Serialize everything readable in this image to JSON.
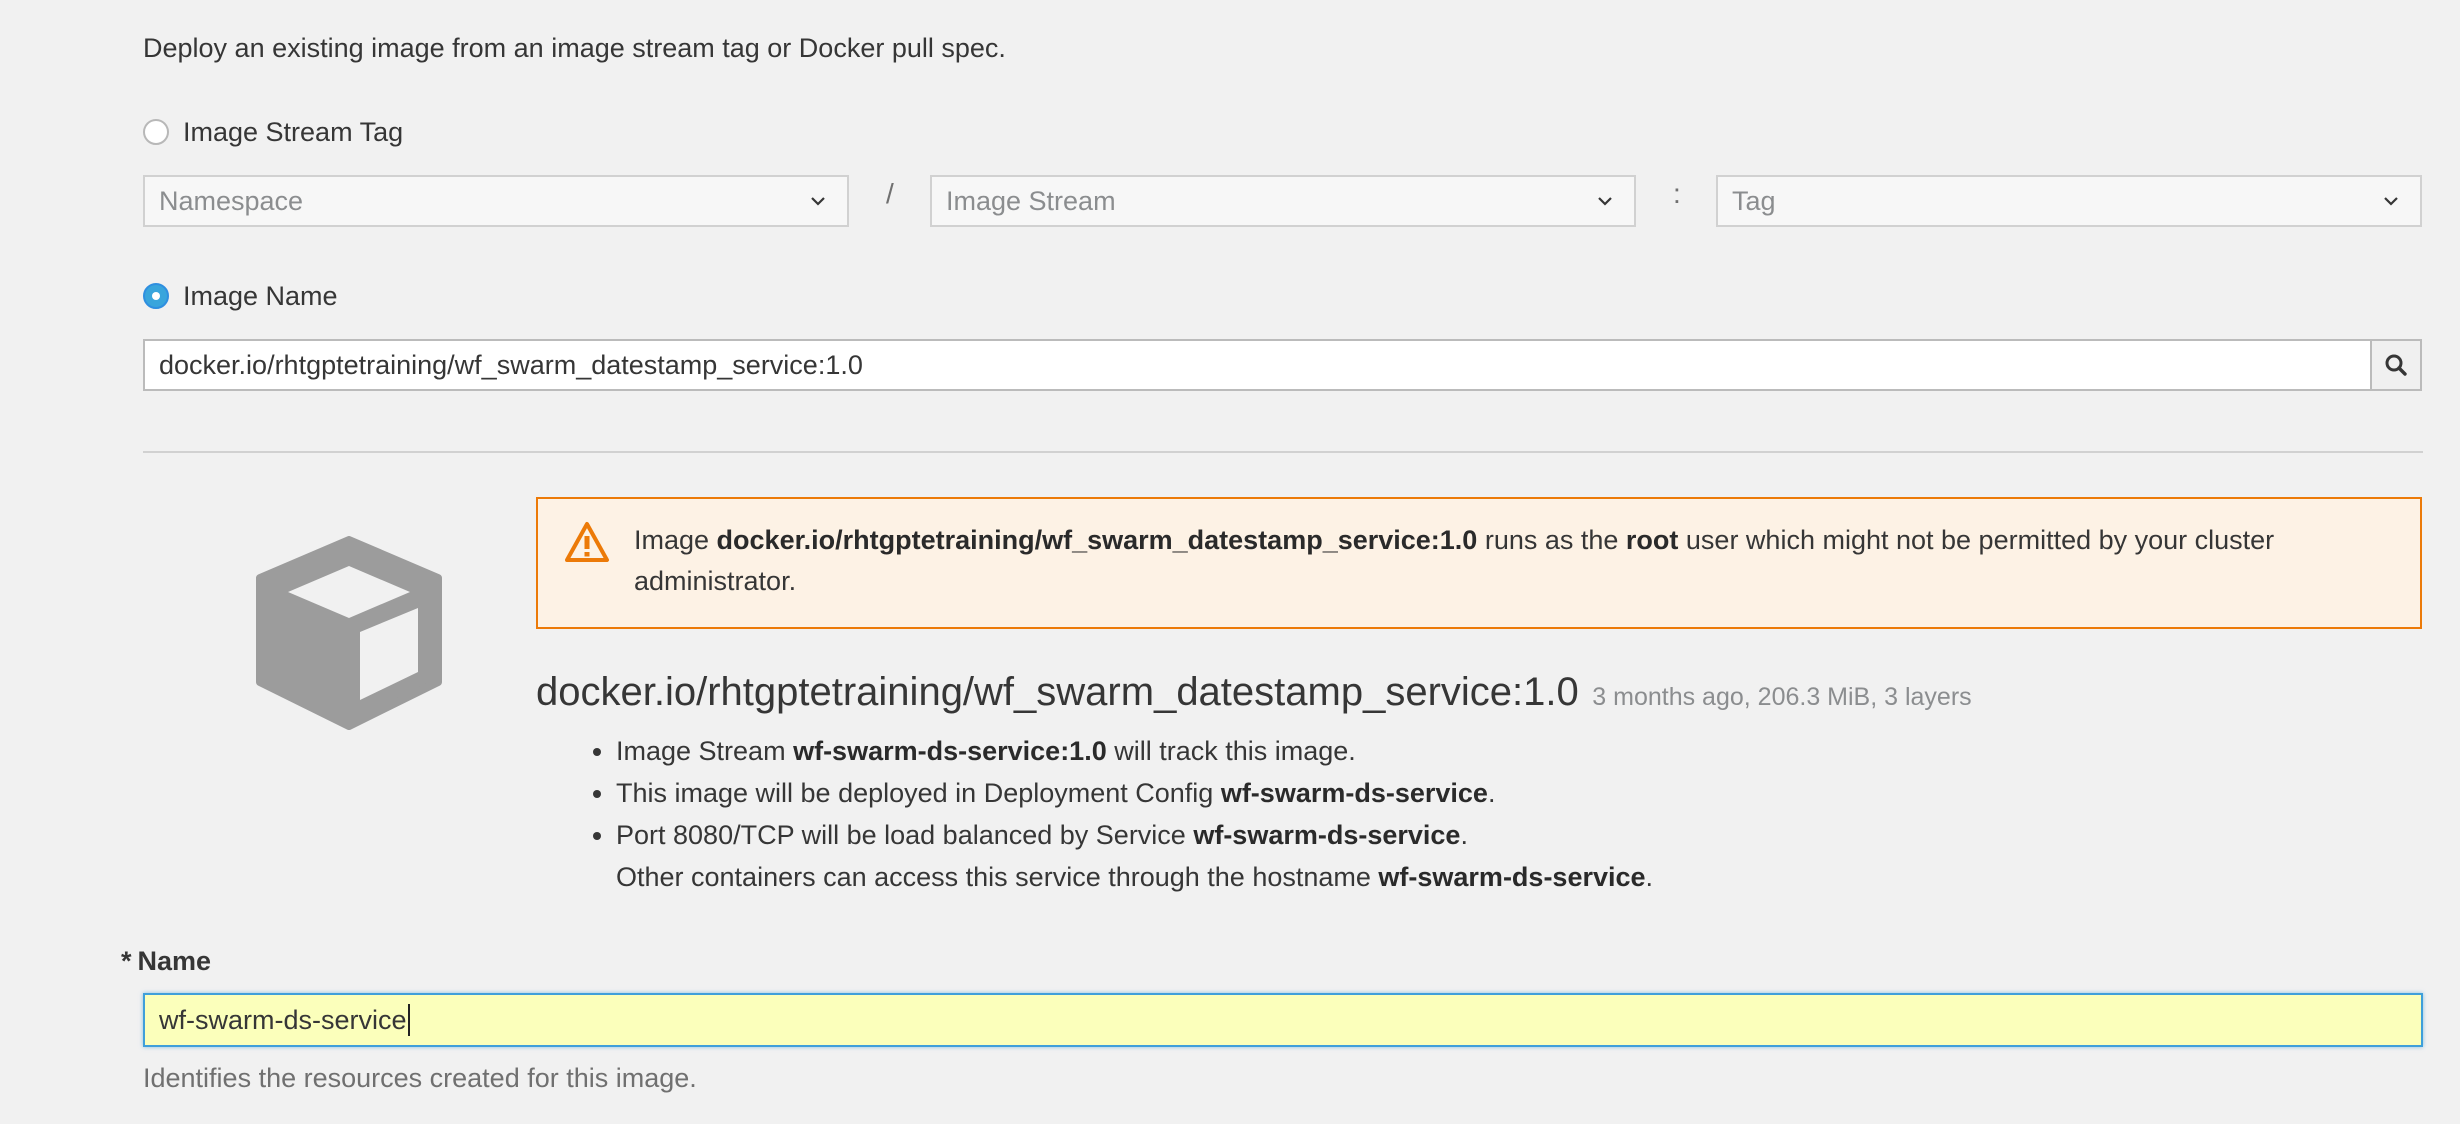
{
  "intro": "Deploy an existing image from an image stream tag or Docker pull spec.",
  "image_stream_tag": {
    "label": "Image Stream Tag",
    "namespace_placeholder": "Namespace",
    "image_stream_placeholder": "Image Stream",
    "tag_placeholder": "Tag",
    "separator_slash": "/",
    "separator_colon": ":"
  },
  "image_name": {
    "label": "Image Name",
    "value": "docker.io/rhtgptetraining/wf_swarm_datestamp_service:1.0"
  },
  "warning": {
    "pre": "Image ",
    "image": "docker.io/rhtgptetraining/wf_swarm_datestamp_service:1.0",
    "mid": " runs as the ",
    "user": "root",
    "post": " user which might not be permitted by your cluster administrator."
  },
  "image_info": {
    "name": "docker.io/rhtgptetraining/wf_swarm_datestamp_service:1.0",
    "meta": "3 months ago, 206.3 MiB, 3 layers"
  },
  "bullets": {
    "b1_pre": "Image Stream ",
    "b1_bold": "wf-swarm-ds-service:1.0",
    "b1_post": " will track this image.",
    "b2_pre": "This image will be deployed in Deployment Config ",
    "b2_bold": "wf-swarm-ds-service",
    "b2_post": ".",
    "b3_pre": "Port 8080/TCP will be load balanced by Service ",
    "b3_bold": "wf-swarm-ds-service",
    "b3_post": ".",
    "b3_line2_pre": "Other containers can access this service through the hostname ",
    "b3_line2_bold": "wf-swarm-ds-service",
    "b3_line2_post": "."
  },
  "name_field": {
    "required_mark": "*",
    "label": "Name",
    "value": "wf-swarm-ds-service",
    "help": "Identifies the resources created for this image."
  },
  "colors": {
    "warning_border": "#ec7a08",
    "warning_bg": "#fdf2e5",
    "focus_border": "#3f9fda",
    "input_highlight": "#fbffbb"
  },
  "icons": [
    "chevron-down-icon",
    "search-icon",
    "warning-triangle-icon",
    "cube-icon"
  ]
}
